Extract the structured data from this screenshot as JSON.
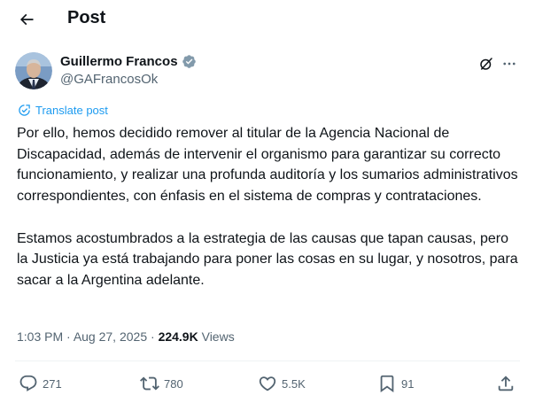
{
  "header": {
    "title": "Post",
    "back_icon": "arrow-left-icon"
  },
  "author": {
    "name": "Guillermo Francos",
    "handle": "@GAFrancosOk",
    "verified_badge": "gray-verified-icon",
    "avatar": "avatar-photo"
  },
  "translate_label": "Translate post",
  "body": {
    "paragraph_1": "Por ello, hemos decidido remover al titular de la Agencia Nacional de Discapacidad, además de intervenir el organismo para garantizar su correcto funcionamiento, y realizar una profunda auditoría y los sumarios administrativos correspondientes, con énfasis en el sistema de compras y contrataciones.",
    "paragraph_2": "Estamos acostumbrados a la estrategia de las causas que tapan causas, pero la Justicia ya está trabajando para poner las cosas en su lugar, y nosotros, para sacar a la Argentina adelante."
  },
  "meta": {
    "time": "1:03 PM",
    "separator": " · ",
    "date": "Aug 27, 2025",
    "separator_2": " · ",
    "views_count": "224.9K",
    "views_label": " Views"
  },
  "actions": {
    "replies": "271",
    "reposts": "780",
    "likes": "5.5K",
    "bookmarks": "91"
  },
  "colors": {
    "accent": "#1d9bf0",
    "secondary_text": "#536471",
    "primary_text": "#0f1419",
    "divider": "#eff3f4"
  }
}
